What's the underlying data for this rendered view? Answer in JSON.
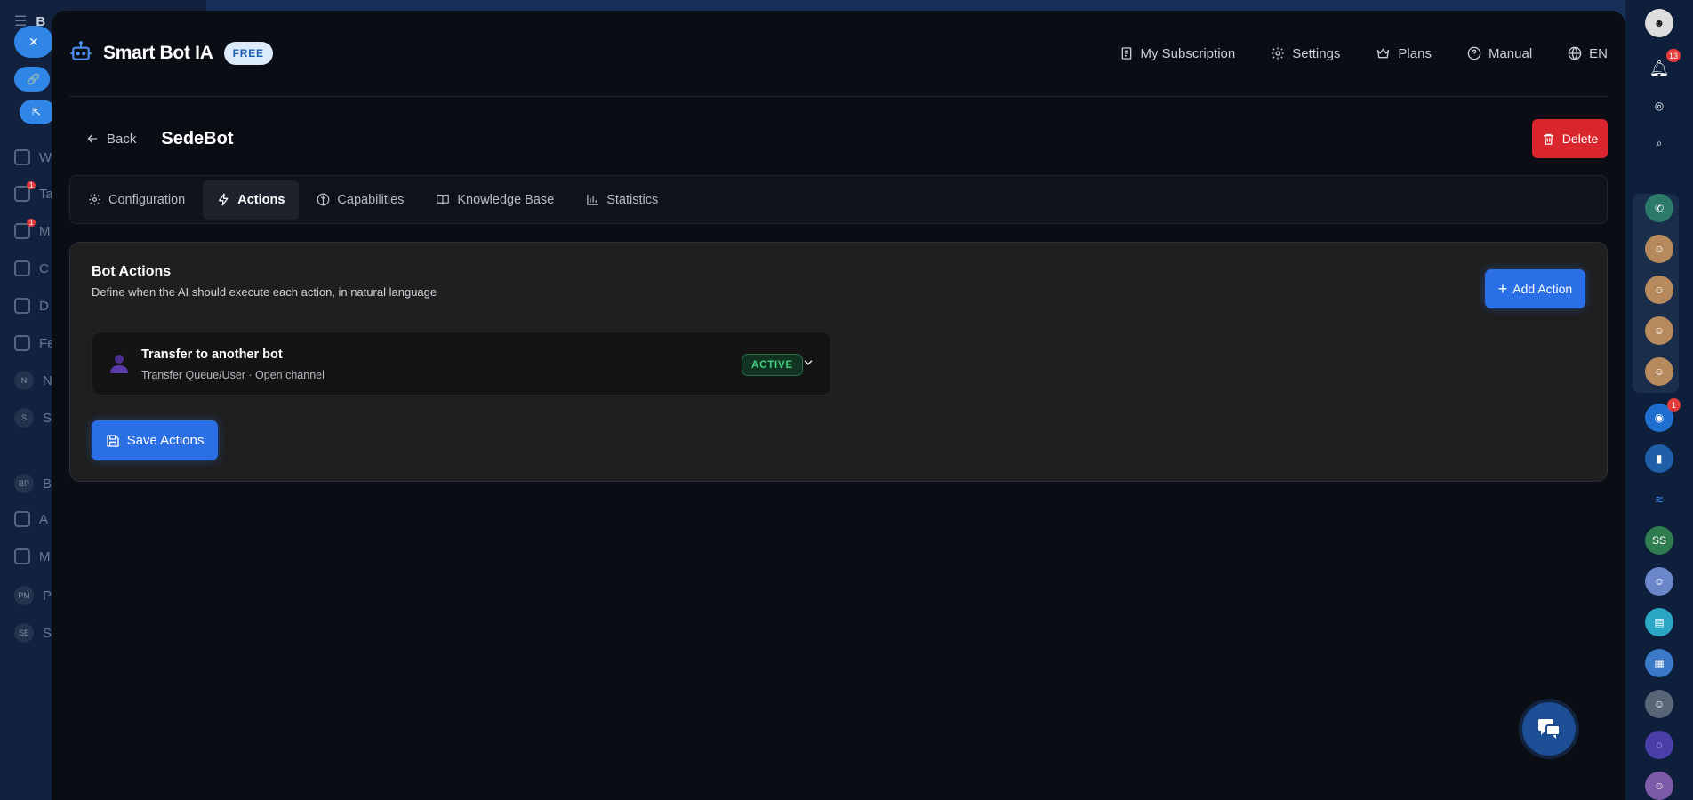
{
  "app": {
    "title": "Smart Bot IA",
    "plan_badge": "FREE"
  },
  "header_nav": [
    {
      "label": "My Subscription",
      "icon": "receipt-icon"
    },
    {
      "label": "Settings",
      "icon": "gear-icon"
    },
    {
      "label": "Plans",
      "icon": "crown-icon"
    },
    {
      "label": "Manual",
      "icon": "help-circle-icon"
    },
    {
      "label": "EN",
      "icon": "globe-icon"
    }
  ],
  "subhead": {
    "back_label": "Back",
    "bot_name": "SedeBot",
    "delete_label": "Delete"
  },
  "tabs": [
    {
      "label": "Configuration",
      "active": false
    },
    {
      "label": "Actions",
      "active": true
    },
    {
      "label": "Capabilities",
      "active": false
    },
    {
      "label": "Knowledge Base",
      "active": false
    },
    {
      "label": "Statistics",
      "active": false
    }
  ],
  "panel": {
    "title": "Bot Actions",
    "subtitle": "Define when the AI should execute each action, in natural language",
    "add_label": "Add Action",
    "save_label": "Save Actions",
    "actions": [
      {
        "name": "Transfer to another bot",
        "description": "Transfer Queue/User · Open channel",
        "status": "ACTIVE"
      }
    ]
  },
  "background": {
    "sidebar_letters": [
      "B",
      "W",
      "Ta",
      "M",
      "C",
      "D",
      "Fe",
      "N",
      "Se",
      "B",
      "A",
      "M",
      "P",
      "Se"
    ],
    "sidebar_badges": [
      "1",
      "1"
    ],
    "sidebar_circles": [
      "N",
      "S",
      "BP",
      "PM",
      "SE"
    ],
    "rail_notifications": "13",
    "rail_badge_chat": "1",
    "rail_initials": "SS"
  },
  "colors": {
    "accent": "#2b6fe6",
    "danger": "#d9262c",
    "success": "#3ed07b",
    "modal_bg": "#0a0d13"
  }
}
